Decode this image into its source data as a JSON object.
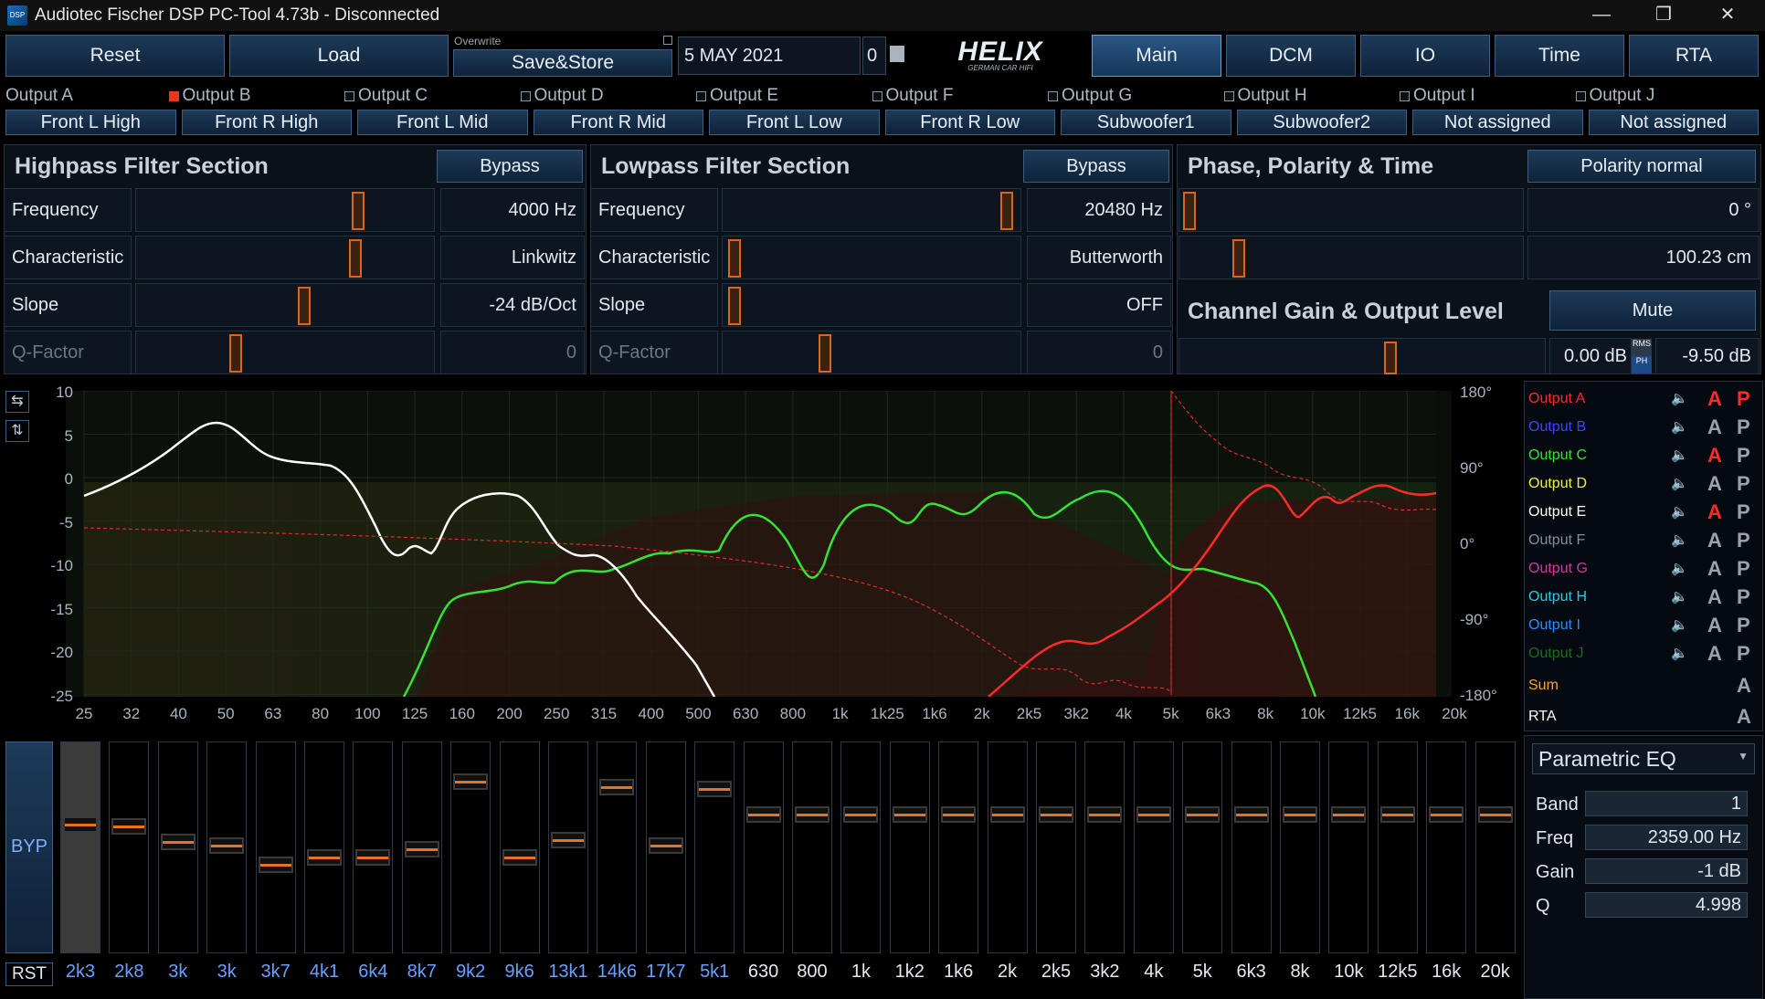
{
  "window": {
    "title": "Audiotec Fischer DSP PC-Tool 4.73b - Disconnected",
    "icon": "app-icon"
  },
  "toolbar": {
    "reset": "Reset",
    "load": "Load",
    "overwrite": "Overwrite",
    "save": "Save&Store",
    "date": "5 MAY 2021",
    "counter": "0",
    "logo": "HELIX",
    "logo_sub": "GERMAN CAR HIFI",
    "tabs": [
      "Main",
      "DCM",
      "IO",
      "Time",
      "RTA"
    ],
    "active_tab": "Main"
  },
  "outputs": [
    {
      "label": "Output A",
      "assign": "Front L High",
      "checked": false
    },
    {
      "label": "Output B",
      "assign": "Front R High",
      "checked": true
    },
    {
      "label": "Output C",
      "assign": "Front L Mid",
      "checked": false
    },
    {
      "label": "Output D",
      "assign": "Front R Mid",
      "checked": false
    },
    {
      "label": "Output E",
      "assign": "Front L Low",
      "checked": false
    },
    {
      "label": "Output F",
      "assign": "Front R Low",
      "checked": false
    },
    {
      "label": "Output G",
      "assign": "Subwoofer1",
      "checked": false
    },
    {
      "label": "Output H",
      "assign": "Subwoofer2",
      "checked": false
    },
    {
      "label": "Output I",
      "assign": "Not assigned",
      "checked": false
    },
    {
      "label": "Output J",
      "assign": "Not assigned",
      "checked": false
    }
  ],
  "highpass": {
    "title": "Highpass Filter Section",
    "bypass": "Bypass",
    "rows": [
      {
        "label": "Frequency",
        "value": "4000 Hz",
        "level": 0.76
      },
      {
        "label": "Characteristic",
        "value": "Linkwitz",
        "level": 0.75
      },
      {
        "label": "Slope",
        "value": "-24 dB/Oct",
        "level": 0.57
      },
      {
        "label": "Q-Factor",
        "value": "0",
        "level": 0.33
      }
    ]
  },
  "lowpass": {
    "title": "Lowpass Filter Section",
    "bypass": "Bypass",
    "rows": [
      {
        "label": "Frequency",
        "value": "20480 Hz",
        "level": 0.98
      },
      {
        "label": "Characteristic",
        "value": "Butterworth",
        "level": 0.02
      },
      {
        "label": "Slope",
        "value": "OFF",
        "level": 0.02
      },
      {
        "label": "Q-Factor",
        "value": "0",
        "level": 0.34
      }
    ]
  },
  "phase": {
    "title": "Phase, Polarity & Time",
    "polarity": "Polarity normal",
    "phase_value": "0 °",
    "time_value": "100.23 cm",
    "phase_level": 0.0,
    "time_level": 0.16
  },
  "gain": {
    "title": "Channel Gain & Output Level",
    "mute": "Mute",
    "gain_value": "0.00 dB",
    "rms": "RMS",
    "ph": "PH",
    "level_value": "-9.50 dB",
    "level": 0.58
  },
  "graph": {
    "y_left": [
      "10",
      "5",
      "0",
      "-5",
      "-10",
      "-15",
      "-20",
      "-25"
    ],
    "y_right": [
      "180°",
      "90°",
      "0°",
      "-90°",
      "-180°"
    ],
    "x": [
      "25",
      "32",
      "40",
      "50",
      "63",
      "80",
      "100",
      "125",
      "160",
      "200",
      "250",
      "315",
      "400",
      "500",
      "630",
      "800",
      "1k",
      "1k25",
      "1k6",
      "2k",
      "2k5",
      "3k2",
      "4k",
      "5k",
      "6k3",
      "8k",
      "10k",
      "12k5",
      "16k",
      "20k"
    ]
  },
  "legend": [
    {
      "name": "Output A",
      "color": "#ff2a2a",
      "a_color": "#ff2a2a",
      "p_color": "#ff2a2a"
    },
    {
      "name": "Output B",
      "color": "#3b44ff",
      "a_color": "#9aa3ad",
      "p_color": "#9aa3ad"
    },
    {
      "name": "Output C",
      "color": "#34e234",
      "a_color": "#ff2a2a",
      "p_color": "#9aa3ad"
    },
    {
      "name": "Output D",
      "color": "#f2f23a",
      "a_color": "#9aa3ad",
      "p_color": "#9aa3ad"
    },
    {
      "name": "Output E",
      "color": "#ffffff",
      "a_color": "#ff2a2a",
      "p_color": "#9aa3ad"
    },
    {
      "name": "Output F",
      "color": "#8a8f96",
      "a_color": "#9aa3ad",
      "p_color": "#9aa3ad"
    },
    {
      "name": "Output G",
      "color": "#d23aa5",
      "a_color": "#9aa3ad",
      "p_color": "#9aa3ad"
    },
    {
      "name": "Output H",
      "color": "#28c9e2",
      "a_color": "#9aa3ad",
      "p_color": "#9aa3ad"
    },
    {
      "name": "Output I",
      "color": "#2a8cff",
      "a_color": "#9aa3ad",
      "p_color": "#9aa3ad"
    },
    {
      "name": "Output J",
      "color": "#1d6b1d",
      "a_color": "#9aa3ad",
      "p_color": "#9aa3ad"
    }
  ],
  "legend_extra": [
    {
      "name": "Sum",
      "color": "#f5a623"
    },
    {
      "name": "RTA",
      "color": "#ffffff"
    }
  ],
  "eq": {
    "byp": "BYP",
    "rst": "RST",
    "bands": [
      {
        "label": "2k3",
        "level": 0.62,
        "active": true
      },
      {
        "label": "2k8",
        "level": 0.61
      },
      {
        "label": "3k",
        "level": 0.53
      },
      {
        "label": "3k",
        "level": 0.51
      },
      {
        "label": "3k7",
        "level": 0.41
      },
      {
        "label": "4k1",
        "level": 0.45
      },
      {
        "label": "6k4",
        "level": 0.45
      },
      {
        "label": "8k7",
        "level": 0.49
      },
      {
        "label": "9k2",
        "level": 0.84
      },
      {
        "label": "9k6",
        "level": 0.45
      },
      {
        "label": "13k1",
        "level": 0.54
      },
      {
        "label": "14k6",
        "level": 0.81
      },
      {
        "label": "17k7",
        "level": 0.51
      },
      {
        "label": "5k1",
        "level": 0.8
      },
      {
        "label": "630",
        "level": 0.67
      },
      {
        "label": "800",
        "level": 0.67
      },
      {
        "label": "1k",
        "level": 0.67
      },
      {
        "label": "1k2",
        "level": 0.67
      },
      {
        "label": "1k6",
        "level": 0.67
      },
      {
        "label": "2k",
        "level": 0.67
      },
      {
        "label": "2k5",
        "level": 0.67
      },
      {
        "label": "3k2",
        "level": 0.67
      },
      {
        "label": "4k",
        "level": 0.67
      },
      {
        "label": "5k",
        "level": 0.67
      },
      {
        "label": "6k3",
        "level": 0.67
      },
      {
        "label": "8k",
        "level": 0.67
      },
      {
        "label": "10k",
        "level": 0.67
      },
      {
        "label": "12k5",
        "level": 0.67
      },
      {
        "label": "16k",
        "level": 0.67
      },
      {
        "label": "20k",
        "level": 0.67
      }
    ]
  },
  "peq": {
    "title": "Parametric EQ",
    "band_label": "Band",
    "band": "1",
    "freq_label": "Freq",
    "freq": "2359.00 Hz",
    "gain_label": "Gain",
    "gain": "-1 dB",
    "q_label": "Q",
    "q": "4.998"
  }
}
